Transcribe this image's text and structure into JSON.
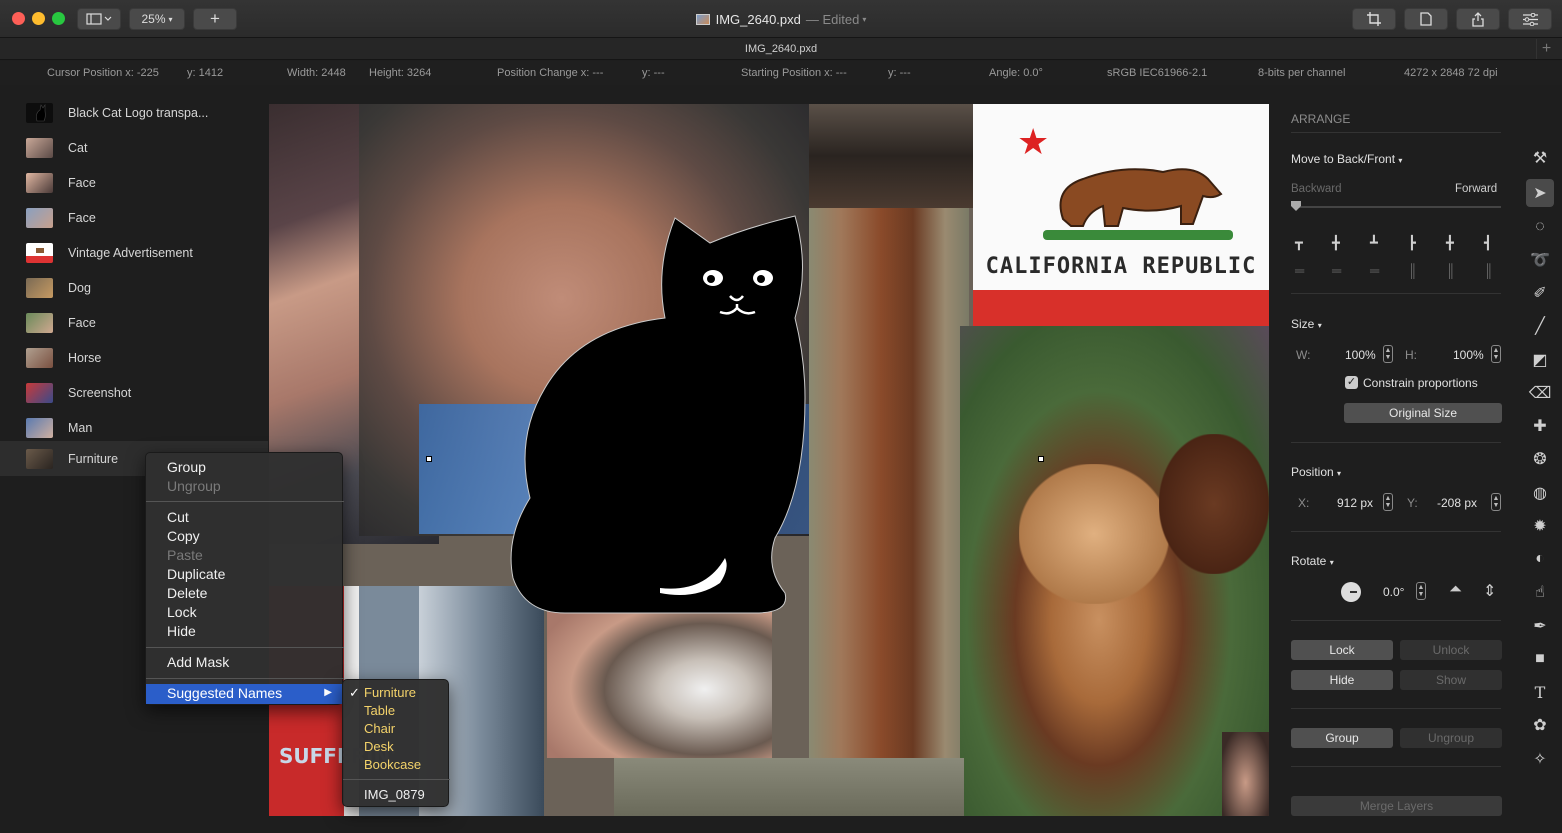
{
  "window": {
    "title": "IMG_2640.pxd",
    "edited_label": "— Edited",
    "tab_title": "IMG_2640.pxd",
    "zoom": "25%",
    "new_tab": "+"
  },
  "info_bar": {
    "cursor_x": "Cursor Position x: -225",
    "cursor_y": "y: 1412",
    "width": "Width: 2448",
    "height": "Height: 3264",
    "pos_change_x": "Position Change x: ---",
    "pos_change_y": "y: ---",
    "start_x": "Starting Position x: ---",
    "start_y": "y: ---",
    "angle": "Angle: 0.0°",
    "color_profile": "sRGB IEC61966-2.1",
    "bit_depth": "8-bits per channel",
    "dimensions": "4272  x 2848 72 dpi"
  },
  "layers": [
    {
      "label": "Black Cat Logo transpa..."
    },
    {
      "label": "Cat"
    },
    {
      "label": "Face"
    },
    {
      "label": "Face"
    },
    {
      "label": "Vintage Advertisement"
    },
    {
      "label": "Dog"
    },
    {
      "label": "Face"
    },
    {
      "label": "Horse"
    },
    {
      "label": "Screenshot"
    },
    {
      "label": "Man"
    },
    {
      "label": "Furniture"
    }
  ],
  "context_menu": {
    "group": "Group",
    "ungroup": "Ungroup",
    "cut": "Cut",
    "copy": "Copy",
    "paste": "Paste",
    "duplicate": "Duplicate",
    "delete": "Delete",
    "lock": "Lock",
    "hide": "Hide",
    "add_mask": "Add Mask",
    "suggested_names": "Suggested Names"
  },
  "submenu": {
    "check": "✓",
    "items": [
      "Furniture",
      "Table",
      "Chair",
      "Desk",
      "Bookcase"
    ],
    "extra": "IMG_0879"
  },
  "canvas": {
    "flag_text": "CALIFORNIA REPUBLIC",
    "poster_text": "SUFFERIN'"
  },
  "arrange_panel": {
    "header": "ARRANGE",
    "move_label": "Move to Back/Front",
    "backward": "Backward",
    "forward": "Forward",
    "size_label": "Size",
    "w_label": "W:",
    "w_value": "100%",
    "h_label": "H:",
    "h_value": "100%",
    "constrain": "Constrain proportions",
    "original_size": "Original Size",
    "position_label": "Position",
    "x_label": "X:",
    "x_value": "912 px",
    "y_label": "Y:",
    "y_value": "-208 px",
    "rotate_label": "Rotate",
    "rotate_value": "0.0°",
    "lock": "Lock",
    "unlock": "Unlock",
    "hide": "Hide",
    "show": "Show",
    "group": "Group",
    "ungroup": "Ungroup",
    "merge": "Merge Layers"
  },
  "tool_icons": [
    "arrange-icon",
    "select-arrow-icon",
    "ellipse-select-icon",
    "lasso-icon",
    "quick-select-icon",
    "brush-icon",
    "gradient-icon",
    "eraser-icon",
    "repair-icon",
    "clone-icon",
    "blur-icon",
    "light-icon",
    "contrast-icon",
    "smudge-icon",
    "pen-icon",
    "shape-icon",
    "text-icon",
    "color-adjust-icon",
    "sparkle-icon"
  ],
  "colors": {
    "accent": "#2b5ec9",
    "suggested_name": "#f3d26a",
    "panel_bg": "#1e1e1e"
  }
}
